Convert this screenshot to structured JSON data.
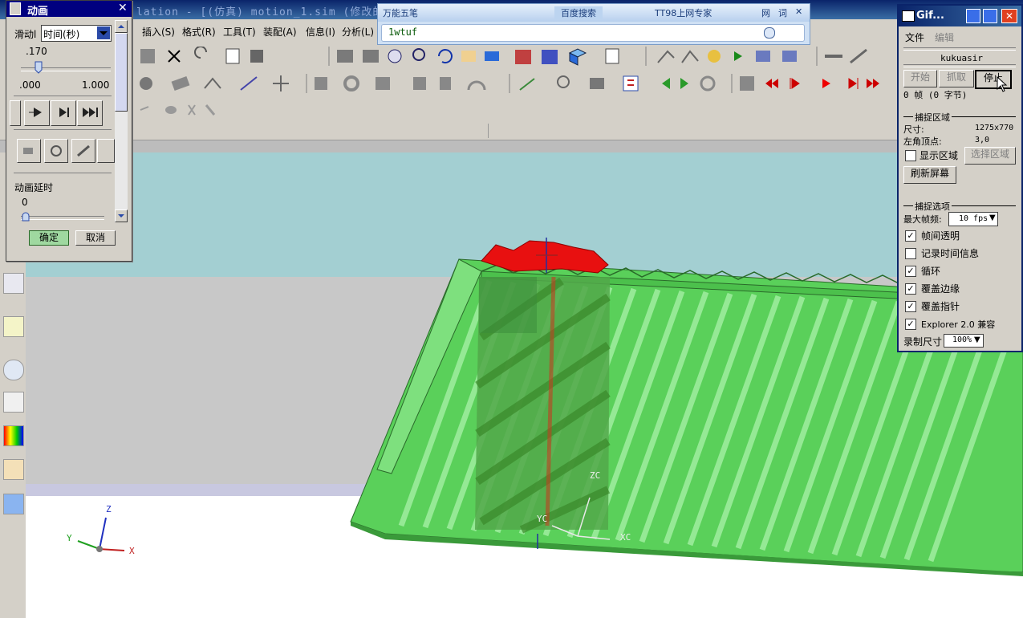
{
  "window": {
    "title": "lation - [(仿真) motion_1.sim (修改的)"
  },
  "menubar": {
    "items": [
      "插入(S)",
      "格式(R)",
      "工具(T)",
      "装配(A)",
      "信息(I)",
      "分析(L)"
    ]
  },
  "ime": {
    "segments": [
      "万能五笔",
      "百度搜索",
      "TT98上网专家",
      "网",
      "词"
    ],
    "close": "✕",
    "input_value": "1wtuf"
  },
  "animation_dialog": {
    "title": "动画",
    "slider_label": "滑动l",
    "time_select": "时间(秒)",
    "current_value": ".170",
    "min": ".000",
    "max": "1.000",
    "delay_label": "动画延时",
    "delay_value": "0",
    "ok": "确定",
    "cancel": "取消",
    "progress": 0.17
  },
  "gif_panel": {
    "title": "Gif...",
    "menu": [
      "文件",
      "编辑"
    ],
    "user": "kukuasir",
    "buttons": {
      "start": "开始",
      "capture": "抓取",
      "stop": "停止"
    },
    "frames": "0 帧 (0 字节)",
    "capture_area_title": "捕捉区域",
    "size_label": "尺寸:",
    "size_value": "1275x770",
    "corner_label": "左角顶点:",
    "corner_value": "3,0",
    "show_area": "显示区域",
    "select_area": "选择区域",
    "refresh": "刷新屏幕",
    "capture_options_title": "捕捉选项",
    "max_fps_label": "最大帧频:",
    "max_fps_value": "10 fps",
    "options": [
      {
        "label": "帧间透明",
        "checked": true
      },
      {
        "label": "记录时间信息",
        "checked": false
      },
      {
        "label": "循环",
        "checked": true
      },
      {
        "label": "覆盖边缘",
        "checked": true
      },
      {
        "label": "覆盖指针",
        "checked": true
      },
      {
        "label": "Explorer 2.0 兼容",
        "checked": true
      }
    ],
    "record_size_label": "录制尺寸",
    "record_size_value": "100%"
  },
  "viewport": {
    "triad_labels": {
      "z": "Z",
      "y": "Y",
      "x": "X"
    },
    "wcs_labels": {
      "zc": "ZC",
      "yc": "YC",
      "xc": "XC"
    },
    "colors": {
      "sky": "#a3cfd2",
      "floor": "#c8c8c8",
      "ground": "#ffffff",
      "rack": "#5ad05a",
      "cutter": "#e81010"
    }
  }
}
